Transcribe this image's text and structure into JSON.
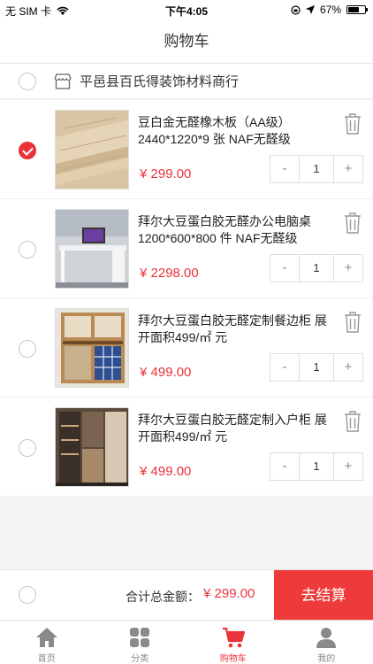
{
  "status_bar": {
    "carrier": "无 SIM 卡",
    "time": "下午4:05",
    "battery": "67%",
    "battery_level": 0.67
  },
  "nav": {
    "title": "购物车"
  },
  "store": {
    "name": "平邑县百氏得装饰材料商行",
    "icon": "shop-icon",
    "checked": false
  },
  "items": [
    {
      "title": "豆白金无醛橡木板（AA级） 2440*1220*9 张 NAF无醛级",
      "price": "¥ 299.00",
      "qty": "1",
      "checked": true,
      "dec": "-",
      "inc": "+"
    },
    {
      "title": "拜尔大豆蛋白胶无醛办公电脑桌 1200*600*800 件 NAF无醛级",
      "price": "¥ 2298.00",
      "qty": "1",
      "checked": false,
      "dec": "-",
      "inc": "+"
    },
    {
      "title": "拜尔大豆蛋白胶无醛定制餐边柜 展开面积499/㎡ 元",
      "price": "¥ 499.00",
      "qty": "1",
      "checked": false,
      "dec": "-",
      "inc": "+"
    },
    {
      "title": "拜尔大豆蛋白胶无醛定制入户柜 展开面积499/㎡ 元",
      "price": "¥ 499.00",
      "qty": "1",
      "checked": false,
      "dec": "-",
      "inc": "+"
    }
  ],
  "footer": {
    "total_label": "合计总金额：",
    "total_amount": "¥ 299.00",
    "checkout_label": "去结算"
  },
  "tabs": [
    {
      "label": "首页",
      "icon": "home-icon",
      "active": false
    },
    {
      "label": "分类",
      "icon": "category-icon",
      "active": false
    },
    {
      "label": "购物车",
      "icon": "cart-icon",
      "active": true
    },
    {
      "label": "我的",
      "icon": "user-icon",
      "active": false
    }
  ],
  "colors": {
    "accent": "#e8333a",
    "checkout_bg": "#ee3a3a",
    "inactive_icon": "#8a8a8a"
  }
}
